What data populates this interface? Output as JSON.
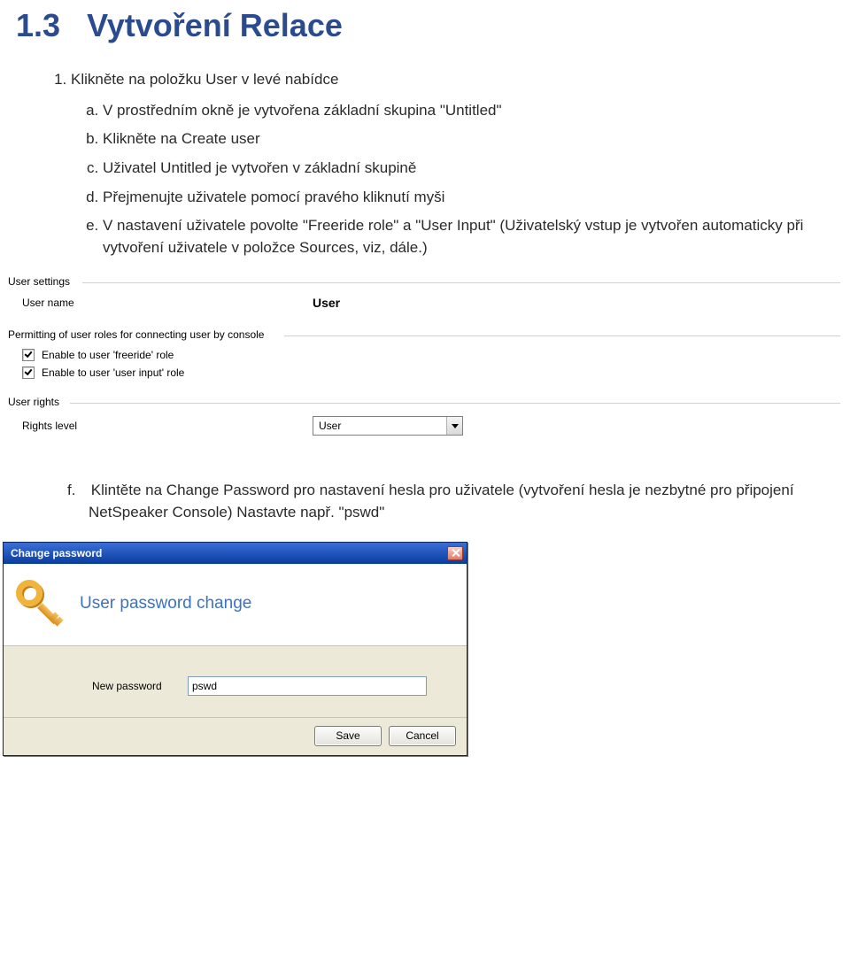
{
  "doc": {
    "section_number": "1.3",
    "section_title": "Vytvoření Relace",
    "step_1": "Klikněte na položku User v levé nabídce",
    "step_a": "V prostředním okně je vytvořena základní skupina \"Untitled\"",
    "step_b": "Klikněte na Create user",
    "step_c": "Uživatel Untitled je vytvořen v základní skupině",
    "step_d": "Přejmenujte uživatele pomocí pravého kliknutí myši",
    "step_e": "V nastavení uživatele povolte \"Freeride role\" a \"User Input\" (Uživatelský vstup je vytvořen automaticky při vytvoření uživatele v položce Sources, viz, dále.)",
    "step_f": "Klintěte na Change Password pro nastavení hesla pro uživatele (vytvoření hesla je nezbytné pro připojení NetSpeaker Console) Nastavte např. \"pswd\""
  },
  "settings": {
    "group_user_settings": "User settings",
    "user_name_label": "User name",
    "user_name_value": "User",
    "group_permitting": "Permitting of user roles for connecting user by console",
    "enable_freeride_label": "Enable to user 'freeride' role",
    "enable_userinput_label": "Enable to user 'user input' role",
    "group_user_rights": "User rights",
    "rights_level_label": "Rights level",
    "rights_level_value": "User"
  },
  "dialog": {
    "title": "Change password",
    "heading": "User password change",
    "new_password_label": "New password",
    "new_password_value": "pswd",
    "save_label": "Save",
    "cancel_label": "Cancel"
  }
}
